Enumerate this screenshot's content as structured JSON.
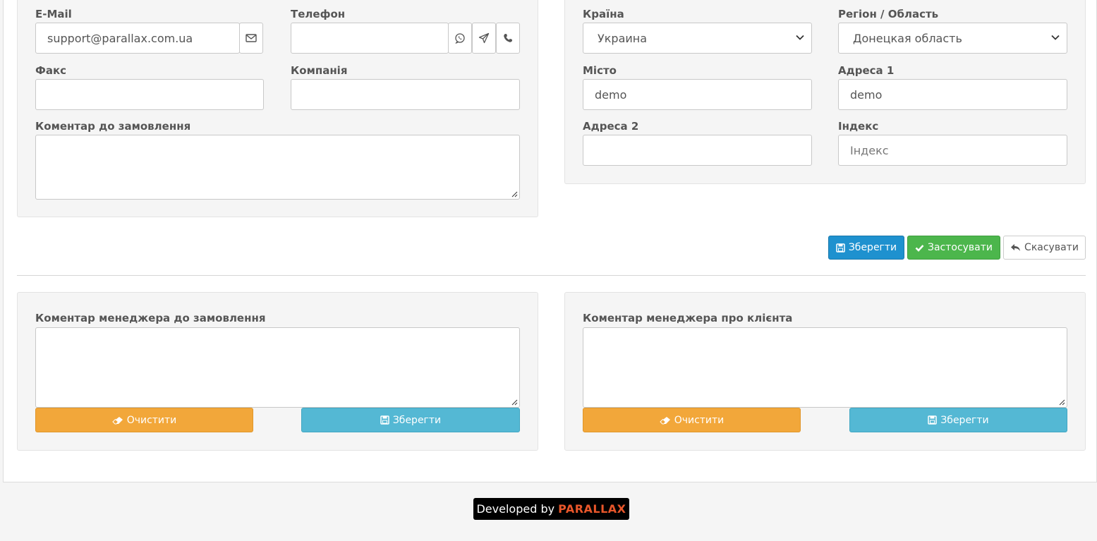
{
  "customer_form": {
    "email_label": "E-Mail",
    "email_value": "support@parallax.com.ua",
    "phone_label": "Телефон",
    "phone_value": "",
    "fax_label": "Факс",
    "fax_value": "",
    "company_label": "Компанія",
    "company_value": "",
    "comment_label": "Коментар до замовлення",
    "comment_value": ""
  },
  "address_form": {
    "country_label": "Країна",
    "country_value": "Украина",
    "region_label": "Регіон / Область",
    "region_value": "Донецкая область",
    "city_label": "Місто",
    "city_value": "demo",
    "address1_label": "Адреса 1",
    "address1_value": "demo",
    "address2_label": "Адреса 2",
    "address2_value": "",
    "postcode_label": "Індекс",
    "postcode_placeholder": "Індекс"
  },
  "actions": {
    "save_label": "Зберегти",
    "apply_label": "Застосувати",
    "cancel_label": "Скасувати"
  },
  "manager_order_comment": {
    "label": "Коментар менеджера до замовлення",
    "clear_label": "Очистити",
    "save_label": "Зберегти"
  },
  "manager_client_comment": {
    "label": "Коментар менеджера про клієнта",
    "clear_label": "Очистити",
    "save_label": "Зберегти"
  },
  "footer": {
    "prefix": "Developed by",
    "brand": "PARALLAX",
    "brand_color": "#e8562a"
  },
  "icons": {
    "email": "envelope-icon",
    "whatsapp": "whatsapp-icon",
    "telegram": "paper-plane-icon",
    "call": "phone-icon",
    "save": "floppy-disk-icon",
    "apply": "check-icon",
    "cancel": "reply-icon",
    "clear": "eraser-icon"
  },
  "colors": {
    "primary": "#1e91cf",
    "success": "#4cb64c",
    "warning": "#f2a73a",
    "info": "#54b8d4"
  }
}
